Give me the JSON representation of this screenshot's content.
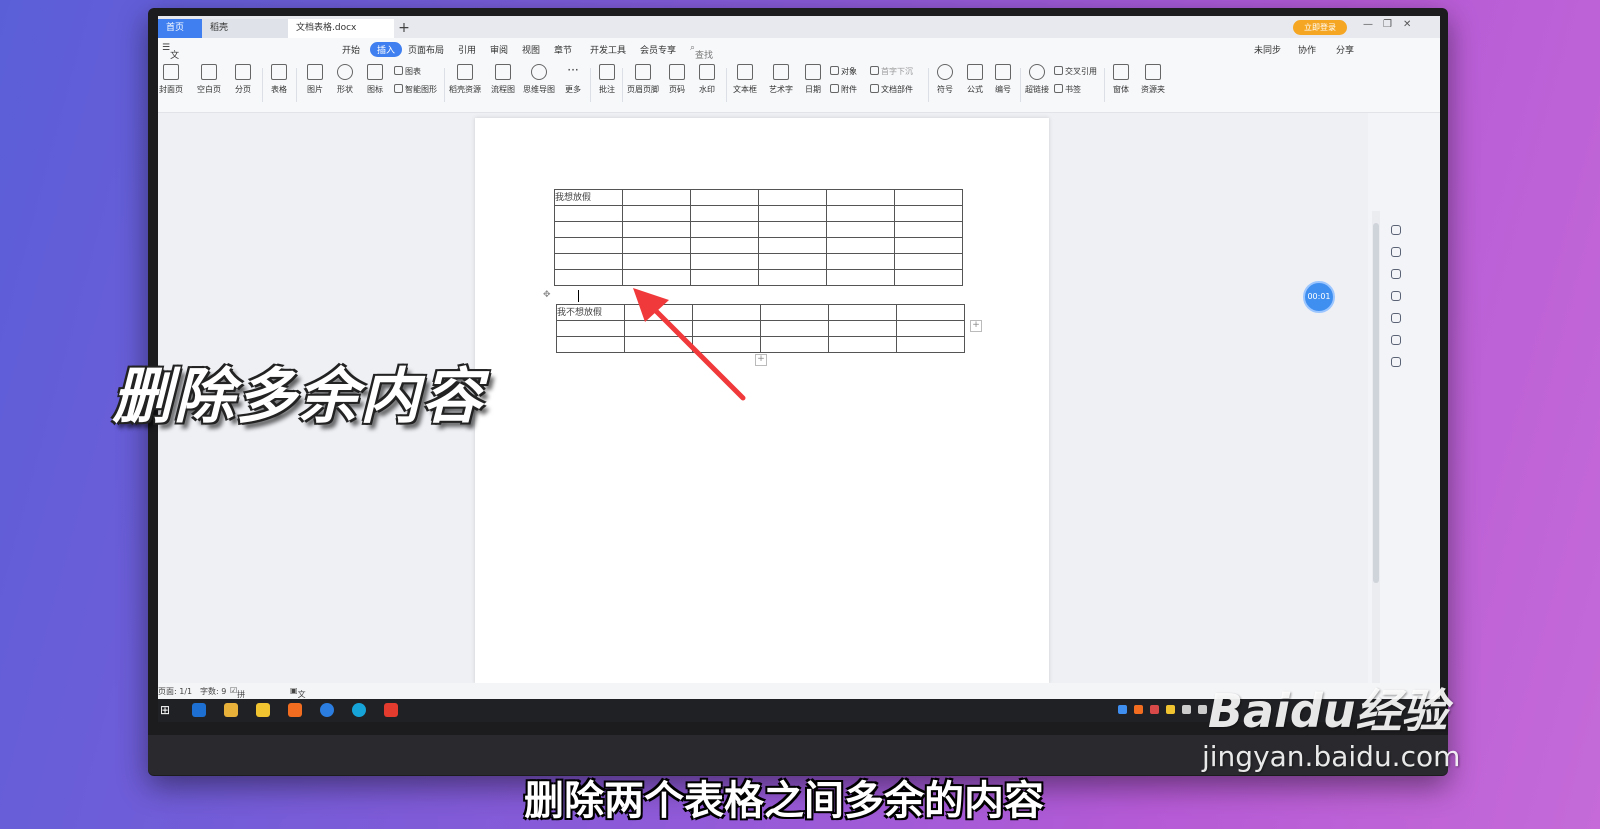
{
  "titlebar": {
    "tabs": [
      "首页",
      "稻壳",
      "文档表格.docx"
    ],
    "add_tab": "+",
    "login": "立即登录"
  },
  "menu": {
    "file": "文件",
    "items": [
      "开始",
      "插入",
      "页面布局",
      "引用",
      "审阅",
      "视图",
      "章节",
      "开发工具",
      "会员专享"
    ],
    "search": "查找命令、搜索模板",
    "right": [
      "未同步",
      "协作",
      "分享"
    ]
  },
  "ribbon": {
    "buttons": [
      "封面页",
      "空白页",
      "分页",
      "表格",
      "图片",
      "形状",
      "图标",
      "稻壳资源",
      "流程图",
      "思维导图",
      "更多",
      "批注",
      "页眉页脚",
      "页码",
      "水印",
      "文本框",
      "艺术字",
      "日期",
      "符号",
      "公式",
      "编号",
      "超链接",
      "窗体",
      "资源夹"
    ],
    "small": [
      "图表",
      "智能图形",
      "对象",
      "附件",
      "首字下沉",
      "文档部件",
      "交叉引用",
      "书签"
    ]
  },
  "document": {
    "table1_cell": "我想放假",
    "table2_cell": "我不想放假",
    "add_col": "+",
    "add_row": "+"
  },
  "timer": "00:01",
  "status": {
    "page": "页面: 1/1",
    "words": "字数: 9",
    "spell": "拼写检查",
    "proof": "文档校对"
  },
  "overlay": {
    "title": "删除多余内容",
    "subtitle": "删除两个表格之间多余的内容",
    "watermark_logo": "Baidu经验",
    "watermark_url": "jingyan.baidu.com"
  },
  "colors": {
    "accent": "#3f7ff0",
    "arrow": "#f0393a"
  }
}
